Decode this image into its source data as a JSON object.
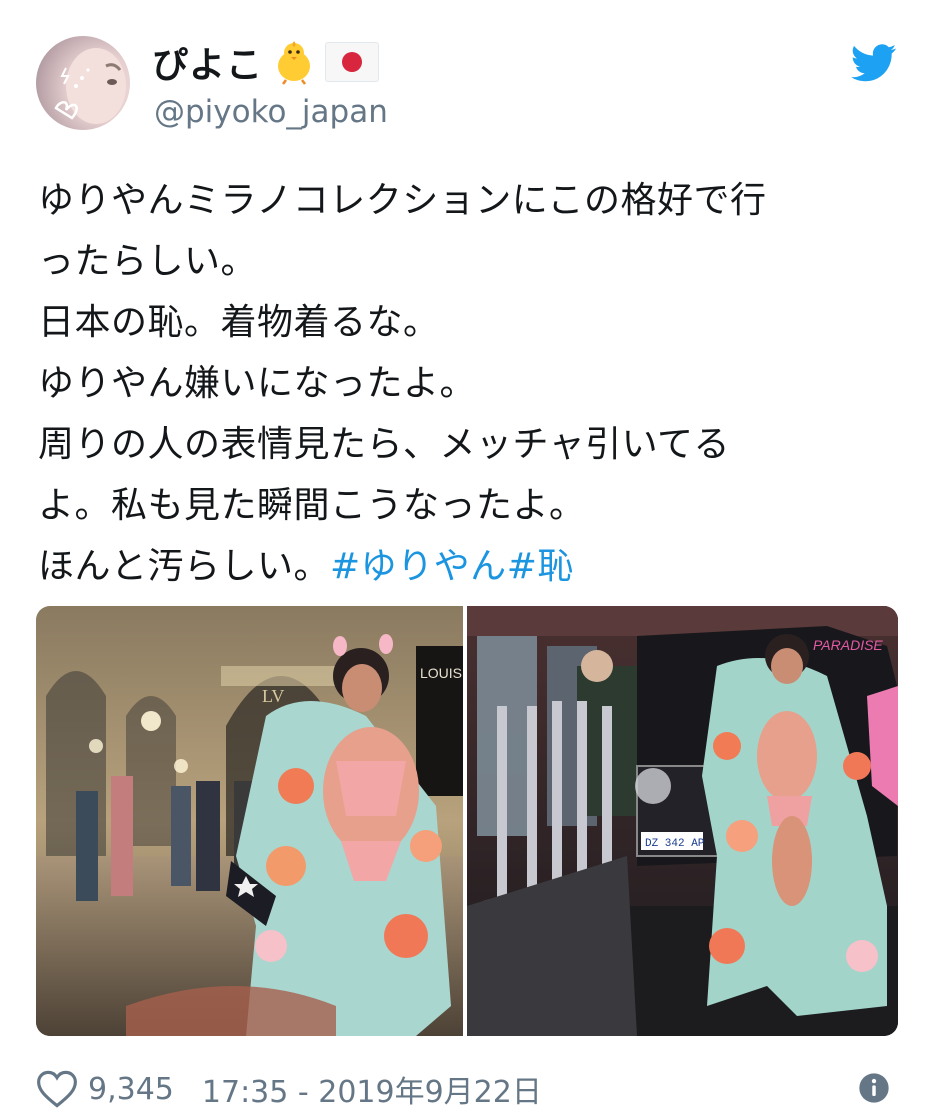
{
  "tweet": {
    "display_name": "ぴよこ",
    "display_name_emoji": [
      "baby-chick-icon",
      "japan-flag-icon"
    ],
    "handle": "@piyoko_japan",
    "text_lines": [
      "ゆりやんミラノコレクションにこの格好で行",
      "ったらしい。",
      "日本の恥。着物着るな。",
      "ゆりやん嫌いになったよ。",
      "周りの人の表情見たら、メッチャ引いてる",
      "よ。私も見た瞬間こうなったよ。",
      "ほんと汚らしい。"
    ],
    "hashtags": [
      "#ゆりやん",
      "#恥"
    ],
    "media": {
      "left_photo_signs": [
        "LOUIS",
        "LV"
      ],
      "right_photo_signs": [
        "PARADISE",
        "DZ 342 AP"
      ]
    },
    "footer": {
      "like_count": "9,345",
      "timestamp": "17:35 - 2019年9月22日"
    }
  },
  "colors": {
    "accent": "#1b95e0",
    "text": "#14171a",
    "muted": "#657786",
    "twitter_blue": "#1da1f2"
  }
}
